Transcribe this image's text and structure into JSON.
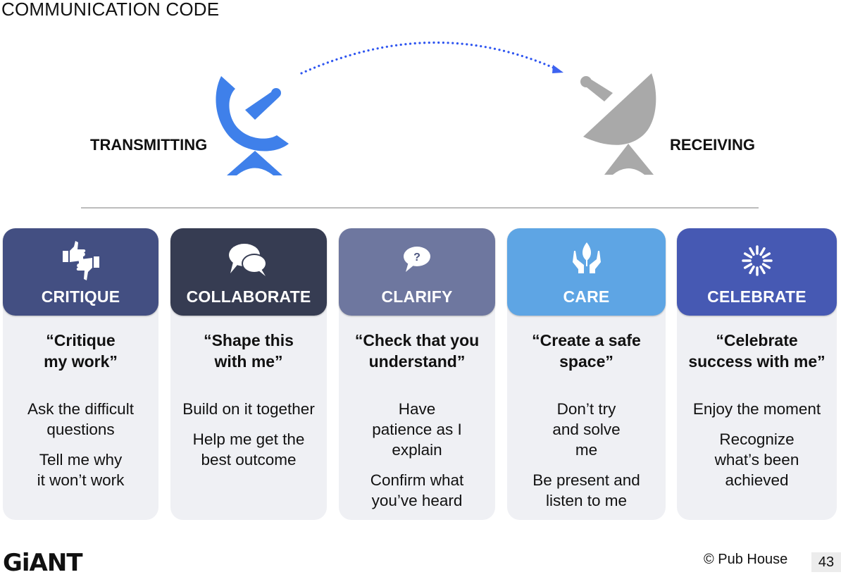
{
  "slide": {
    "title": "COMMUNICATION CODE",
    "transmitting_label": "TRANSMITTING",
    "receiving_label": "RECEIVING",
    "colors": {
      "transmit": "#3f80ea",
      "receive": "#a9a9a9",
      "arc": "#2f56f0",
      "divider": "#bdbdbd",
      "card_body": "#eff0f4"
    }
  },
  "cards": [
    {
      "name": "CRITIQUE",
      "icon": "thumbs-up-down-icon",
      "color": "#434f82",
      "quote_line1": "“Critique",
      "quote_line2": "my work”",
      "points": [
        "Ask the difficult questions",
        "Tell me why it won’t work"
      ]
    },
    {
      "name": "COLLABORATE",
      "icon": "speech-bubbles-icon",
      "color": "#363c52",
      "quote_line1": "“Shape this",
      "quote_line2": "with me”",
      "points": [
        "Build on it together",
        "Help me get the best outcome"
      ]
    },
    {
      "name": "CLARIFY",
      "icon": "question-bubble-icon",
      "color": "#6e779f",
      "quote_line1": "“Check that you",
      "quote_line2": "understand”",
      "points": [
        "Have patience as I explain",
        "Confirm what you’ve heard"
      ]
    },
    {
      "name": "CARE",
      "icon": "hands-leaf-icon",
      "color": "#5ea5e4",
      "quote_line1": "“Create a safe",
      "quote_line2": "space”",
      "points": [
        "Don’t try and solve me",
        "Be present and listen to me"
      ]
    },
    {
      "name": "CELEBRATE",
      "icon": "burst-icon",
      "color": "#4659b3",
      "quote_line1": "“Celebrate",
      "quote_line2": "success with me”",
      "points": [
        "Enjoy the moment",
        "Recognize what’s been achieved"
      ]
    }
  ],
  "footer": {
    "logo": "GiANT",
    "copyright": "© Pub House",
    "page_number": "43"
  }
}
